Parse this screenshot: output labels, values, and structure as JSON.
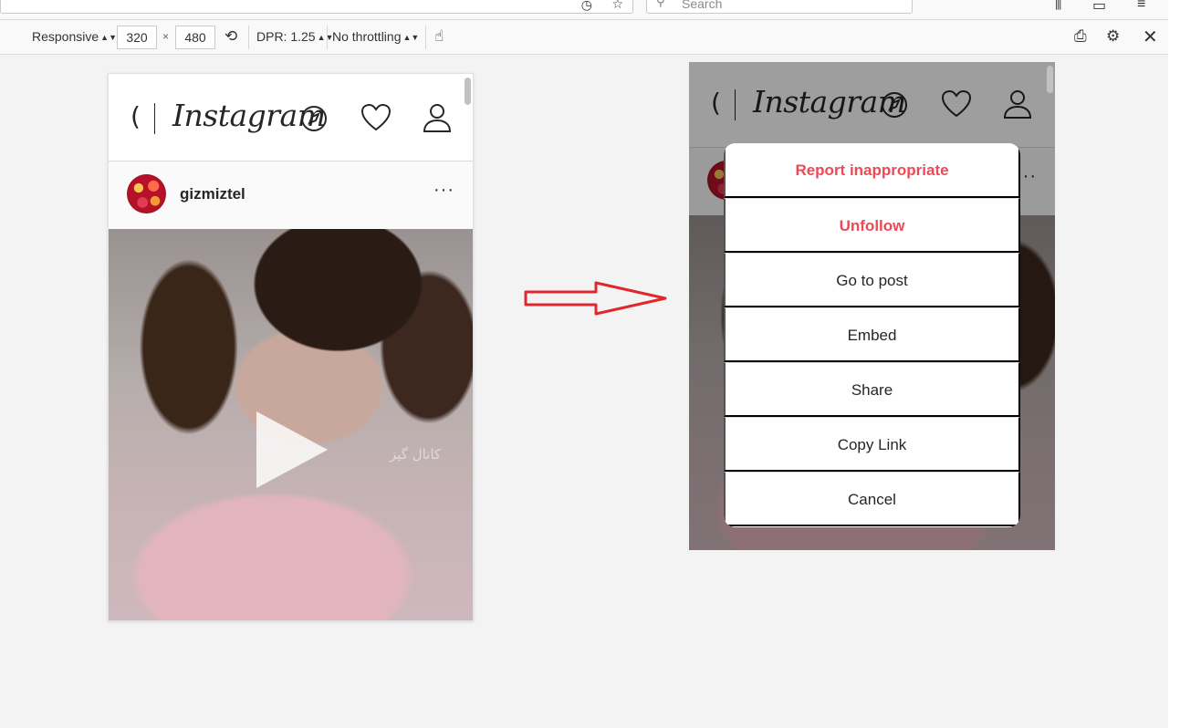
{
  "browser": {
    "search_placeholder": "Search",
    "icons": [
      "reader-view-icon",
      "bookmark-star-icon",
      "library-icon",
      "sidebar-icon",
      "menu-icon"
    ]
  },
  "rdm_toolbar": {
    "device": "Responsive",
    "width": "320",
    "times": "×",
    "height": "480",
    "dpr": "DPR: 1.25",
    "throttling": "No throttling",
    "icons": [
      "rotate-icon",
      "touch-simulation-icon",
      "screenshot-icon",
      "settings-gear-icon",
      "close-icon"
    ]
  },
  "instagram": {
    "logo": "Instagram",
    "username": "gizmiztel",
    "more": "···",
    "watermark": "كانال گيز",
    "icons": [
      "camera-icon",
      "compass-icon",
      "heart-icon",
      "profile-icon",
      "play-icon"
    ]
  },
  "modal": {
    "options": [
      {
        "label": "Report inappropriate",
        "style": "danger"
      },
      {
        "label": "Unfollow",
        "style": "danger"
      },
      {
        "label": "Go to post",
        "style": "normal"
      },
      {
        "label": "Embed",
        "style": "normal"
      },
      {
        "label": "Share",
        "style": "normal"
      },
      {
        "label": "Copy Link",
        "style": "normal"
      },
      {
        "label": "Cancel",
        "style": "normal"
      }
    ]
  },
  "colors": {
    "danger": "#ed4956",
    "arrow": "#e0282c",
    "canvas": "#f3f3f3",
    "text": "#262626"
  }
}
